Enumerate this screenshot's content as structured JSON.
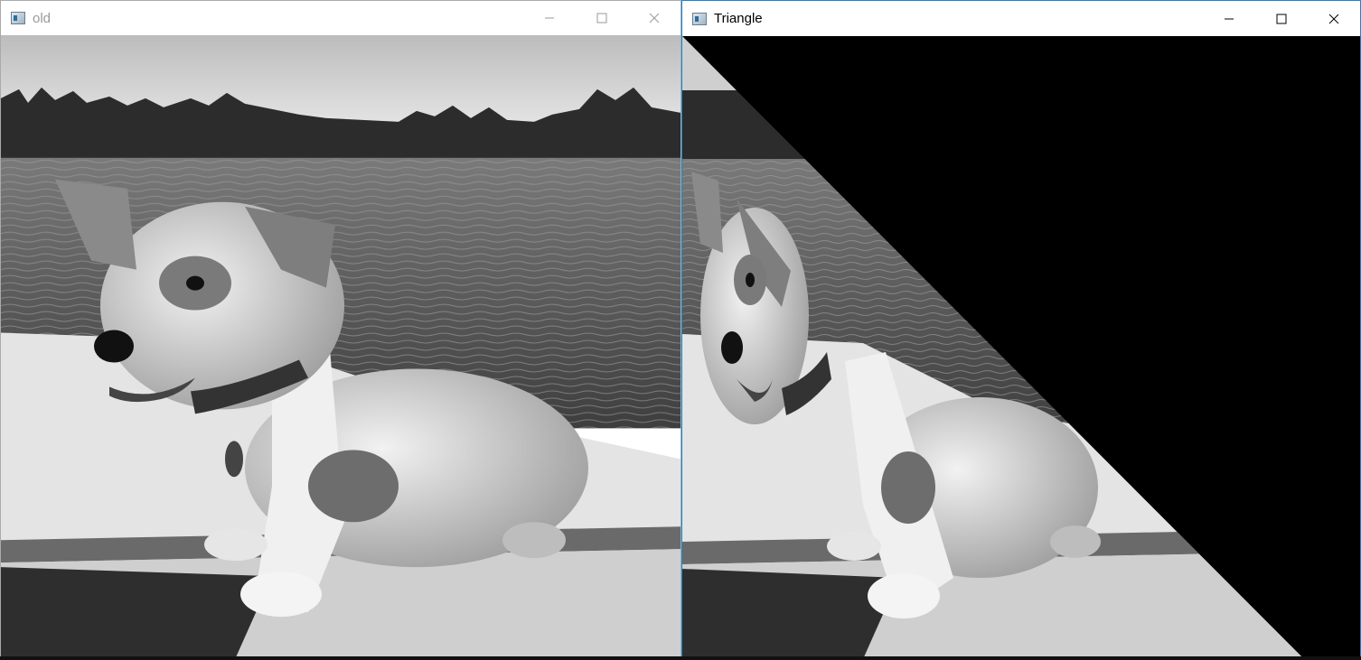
{
  "windows": {
    "left": {
      "title": "old",
      "controls": {
        "minimize_icon": "minimize-icon",
        "maximize_icon": "maximize-icon",
        "close_icon": "close-icon"
      }
    },
    "right": {
      "title": "Triangle",
      "controls": {
        "minimize_icon": "minimize-icon",
        "maximize_icon": "maximize-icon",
        "close_icon": "close-icon"
      }
    }
  },
  "colors": {
    "active_border": "#1883d7",
    "inactive_border": "#aaaaaa",
    "inactive_title": "#999999",
    "active_title": "#000000"
  }
}
